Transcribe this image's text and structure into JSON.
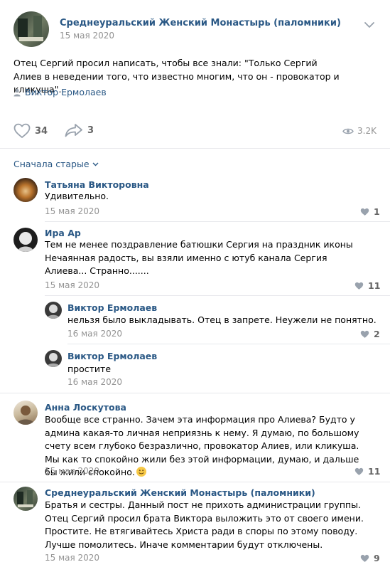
{
  "post": {
    "group_name": "Среднеуральский Женский Монастырь (паломники)",
    "date": "15 мая 2020",
    "text": "Отец Сергий просил написать, чтобы все знали: \"Только Сергий Алиев в неведении того, что известно многим, что он - провокатор и кликуша\".",
    "signer": "Виктор Ермолаев",
    "likes": "34",
    "shares": "3",
    "views": "3.2K"
  },
  "sort": {
    "label": "Сначала старые"
  },
  "comments": [
    {
      "author": "Татьяна Викторовна",
      "text": "Удивительно.",
      "date": "15 мая 2020",
      "likes": "1"
    },
    {
      "author": "Ира Ар",
      "text": "Тем не менее поздравление батюшки Сергия на праздник иконы Нечаянная радость, вы взяли именно с ютуб канала Сергия Алиева... Странно.......",
      "date": "15 мая 2020",
      "likes": "11",
      "replies": [
        {
          "author": "Виктор Ермолаев",
          "text": "нельзя было выкладывать. Отец в запрете. Неужели не понятно.",
          "date": "16 мая 2020",
          "likes": "2"
        },
        {
          "author": "Виктор Ермолаев",
          "text": "простите",
          "date": "16 мая 2020"
        }
      ]
    },
    {
      "author": "Анна Лоскутова",
      "text": "Вообще все странно. Зачем эта информация про Алиева? Будто у админа какая-то личная неприязнь к нему. Я думаю, по большому счету всем глубоко безразлично, провокатор Алиев, или кликуша. Мы как то спокойно жили без этой информации, думаю, и дальше бы жили спокойно.",
      "date": "15 мая 2020",
      "likes": "11"
    },
    {
      "author": "Среднеуральский Женский Монастырь (паломники)",
      "text": "Братья и сестры. Данный пост не прихоть администрации группы. Отец Сергий просил брата Виктора выложить это от своего имени. Простите. Не втягивайтесь Христа ради в споры по этому поводу. Лучше помолитесь. Иначе комментарии будут отключены.",
      "date": "15 мая 2020",
      "likes": "9"
    }
  ],
  "colors": {
    "link": "#2a5885",
    "muted": "#939393",
    "icon": "#99a2ad",
    "divider": "#e7e8ec"
  }
}
